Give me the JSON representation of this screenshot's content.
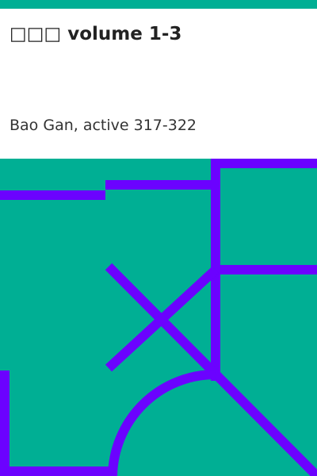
{
  "cover": {
    "title": "□□□ volume 1-3",
    "author": "Bao Gan, active 317-322"
  },
  "colors": {
    "teal": "#00af94",
    "purple": "#6b02ff",
    "background": "#ffffff",
    "text": "#222222"
  }
}
